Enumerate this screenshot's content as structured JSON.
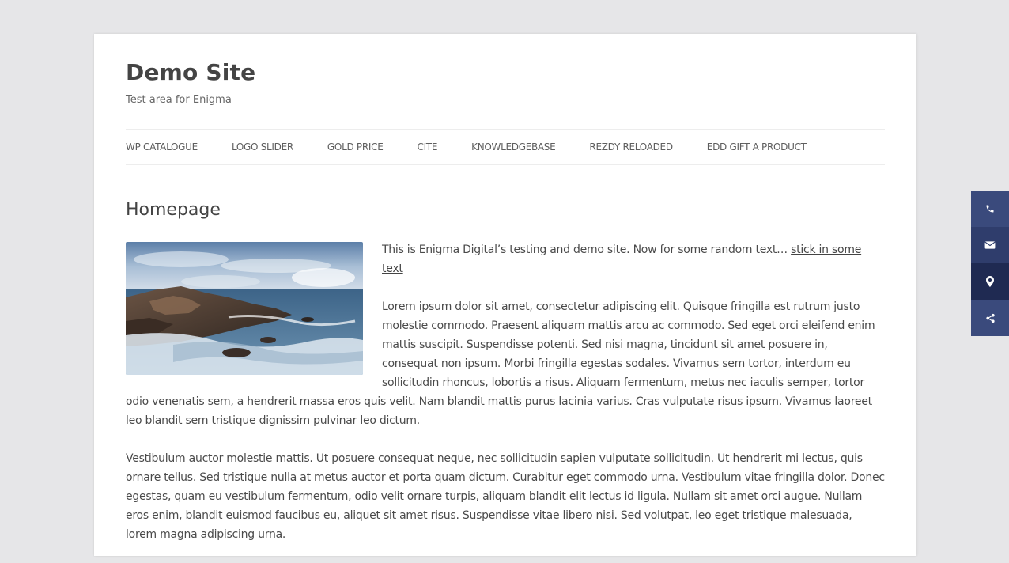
{
  "site": {
    "title": "Demo Site",
    "tagline": "Test area for Enigma"
  },
  "nav": {
    "items": [
      {
        "label": "WP CATALOGUE"
      },
      {
        "label": "LOGO SLIDER"
      },
      {
        "label": "GOLD PRICE"
      },
      {
        "label": "CITE"
      },
      {
        "label": "KNOWLEDGEBASE"
      },
      {
        "label": "REZDY RELOADED"
      },
      {
        "label": "EDD GIFT A PRODUCT"
      }
    ]
  },
  "main": {
    "heading": "Homepage",
    "intro_text": "This is Enigma Digital’s testing and demo site. Now for some random text… ",
    "intro_link": "stick in some text",
    "paragraph_1": "Lorem ipsum dolor sit amet, consectetur adipiscing elit. Quisque fringilla est rutrum justo molestie commodo. Praesent aliquam mattis arcu ac commodo. Sed eget orci eleifend enim mattis suscipit. Suspendisse potenti. Sed nisi magna, tincidunt sit amet posuere in, consequat non ipsum. Morbi fringilla egestas sodales. Vivamus sem tortor, interdum eu sollicitudin rhoncus, lobortis a risus. Aliquam fermentum, metus nec iaculis semper, tortor odio venenatis sem, a hendrerit massa eros quis velit. Nam blandit mattis purus lacinia varius. Cras vulputate risus ipsum. Vivamus laoreet leo blandit sem tristique dignissim pulvinar leo dictum.",
    "paragraph_2": "Vestibulum auctor molestie mattis. Ut posuere consequat neque, nec sollicitudin sapien vulputate sollicitudin. Ut hendrerit mi lectus, quis ornare tellus. Sed tristique nulla at metus auctor et porta quam dictum. Curabitur eget commodo urna. Vestibulum vitae fringilla dolor. Donec egestas, quam eu vestibulum fermentum, odio velit ornare turpis, aliquam blandit elit lectus id ligula. Nullam sit amet orci augue. Nullam eros enim, blandit euismod faucibus eu, aliquet sit amet risus. Suspendisse vitae libero nisi. Sed volutpat, leo eget tristique malesuada, lorem magna adipiscing urna."
  },
  "side_contact": {
    "buttons": [
      {
        "icon": "phone-icon",
        "color": "#3a4a7c"
      },
      {
        "icon": "email-icon",
        "color": "#2f3d6c"
      },
      {
        "icon": "map-marker-icon",
        "color": "#1f2a52"
      },
      {
        "icon": "share-icon",
        "color": "#3a4a7c"
      }
    ]
  }
}
